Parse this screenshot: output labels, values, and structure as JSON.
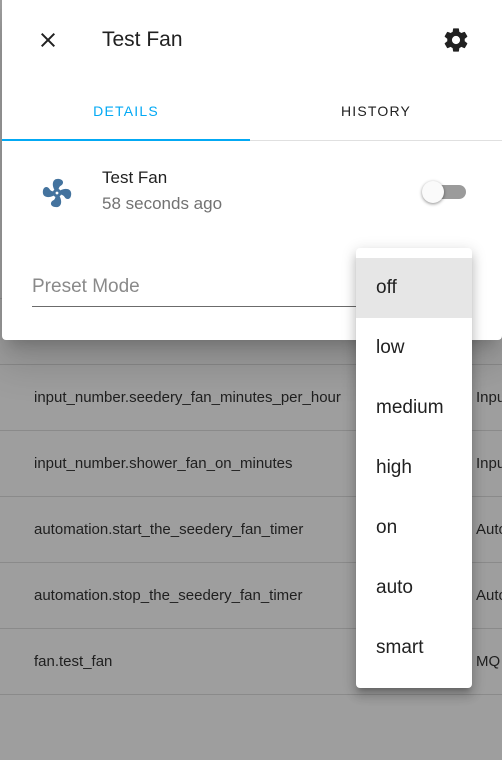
{
  "background_table": {
    "rows": [
      {
        "entity": "",
        "type": ""
      },
      {
        "entity": "input_number.seedery_fan_minutes_per_hour",
        "type": "Inpu"
      },
      {
        "entity": "input_number.shower_fan_on_minutes",
        "type": "Inpu"
      },
      {
        "entity": "automation.start_the_seedery_fan_timer",
        "type": "Auto"
      },
      {
        "entity": "automation.stop_the_seedery_fan_timer",
        "type": "Auto"
      },
      {
        "entity": "fan.test_fan",
        "type": "MQ"
      }
    ]
  },
  "dialog": {
    "title": "Test Fan",
    "icons": {
      "close": "close-icon",
      "settings": "gear-icon",
      "entity": "fan-icon"
    },
    "tabs": [
      {
        "label": "DETAILS",
        "active": true
      },
      {
        "label": "HISTORY",
        "active": false
      }
    ],
    "entity": {
      "name": "Test Fan",
      "last_changed": "58 seconds ago",
      "state_on": false
    },
    "preset_mode": {
      "label": "Preset Mode"
    }
  },
  "dropdown": {
    "options": [
      "off",
      "low",
      "medium",
      "high",
      "on",
      "auto",
      "smart"
    ],
    "highlighted": "off"
  },
  "colors": {
    "accent": "#03a9f4",
    "icon_blue": "#44739e",
    "scrim_background": "#9e9e9e"
  }
}
